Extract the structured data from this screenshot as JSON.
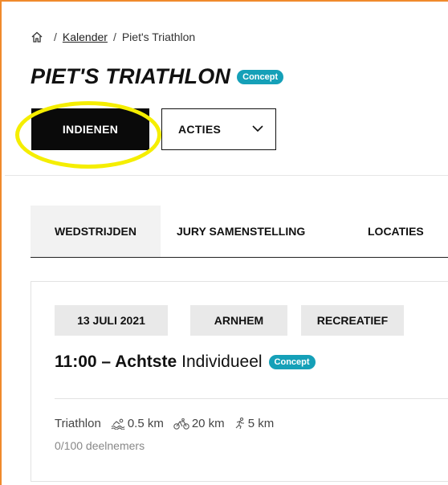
{
  "breadcrumb": {
    "separator": "/",
    "link": "Kalender",
    "current": "Piet's Triathlon"
  },
  "header": {
    "title": "PIET'S TRIATHLON",
    "status_badge": "Concept"
  },
  "buttons": {
    "submit": "INDIENEN",
    "actions": "ACTIES"
  },
  "tabs": [
    {
      "label": "WEDSTRIJDEN",
      "active": true
    },
    {
      "label": "JURY SAMENSTELLING",
      "active": false
    },
    {
      "label": "LOCATIES",
      "active": false
    }
  ],
  "race": {
    "tags": [
      "13 JULI 2021",
      "ARNHEM",
      "RECREATIEF"
    ],
    "time": "11:00 – Achtste",
    "category": "Individueel",
    "status_badge": "Concept",
    "sport": "Triathlon",
    "swim": "0.5 km",
    "bike": "20 km",
    "run": "5 km",
    "participants": "0/100 deelnemers"
  },
  "colors": {
    "badge": "#15a0b8",
    "highlight": "#f5ee00",
    "frame": "#f08a2c",
    "primary_button": "#0a0a0a"
  }
}
